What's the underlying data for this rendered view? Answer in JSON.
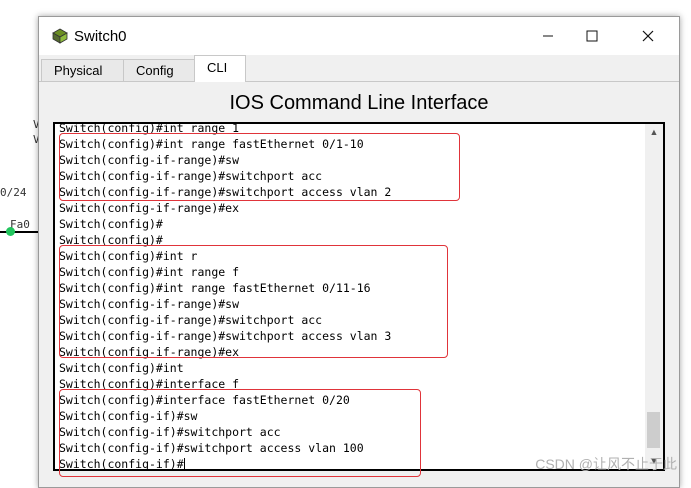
{
  "background": {
    "frag1": "V",
    "frag2": "V",
    "frag3": "0/24",
    "frag4": "Fa0"
  },
  "window": {
    "title": "Switch0",
    "minimize_icon": "minimize-icon",
    "maximize_icon": "maximize-icon",
    "close_icon": "close-icon"
  },
  "tabs": [
    {
      "label": "Physical"
    },
    {
      "label": "Config"
    },
    {
      "label": "CLI"
    }
  ],
  "cli": {
    "heading": "IOS Command Line Interface",
    "lines": [
      "Switch(config)#int range 1",
      "Switch(config)#int range fastEthernet 0/1-10",
      "Switch(config-if-range)#sw",
      "Switch(config-if-range)#switchport acc",
      "Switch(config-if-range)#switchport access vlan 2",
      "Switch(config-if-range)#ex",
      "Switch(config)#",
      "Switch(config)#",
      "Switch(config)#int r",
      "Switch(config)#int range f",
      "Switch(config)#int range fastEthernet 0/11-16",
      "Switch(config-if-range)#sw",
      "Switch(config-if-range)#switchport acc",
      "Switch(config-if-range)#switchport access vlan 3",
      "Switch(config-if-range)#ex",
      "Switch(config)#int",
      "Switch(config)#interface f",
      "Switch(config)#interface fastEthernet 0/20",
      "Switch(config-if)#sw",
      "Switch(config-if)#switchport acc",
      "Switch(config-if)#switchport access vlan 100",
      "Switch(config-if)#"
    ]
  },
  "watermark": "CSDN @让风不止于此"
}
